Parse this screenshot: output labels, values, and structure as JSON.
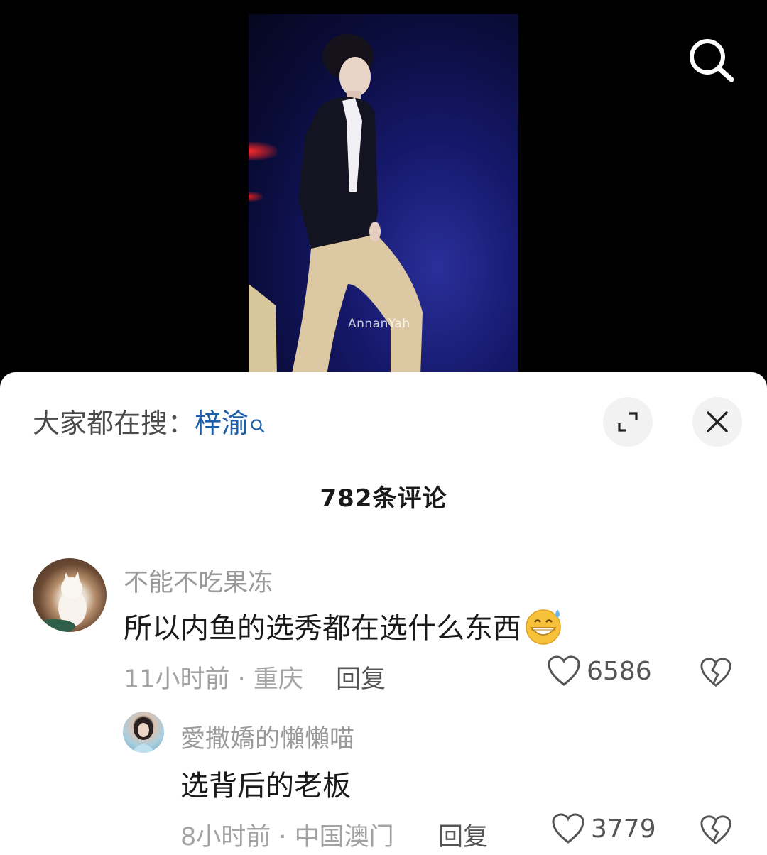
{
  "video": {
    "watermark": "AnnanYah"
  },
  "sheet": {
    "hot_search_label": "大家都在搜：",
    "hot_search_term": "梓渝",
    "comment_count": "782条评论"
  },
  "comments": [
    {
      "username": "不能不吃果冻",
      "text": "所以内鱼的选秀都在选什么东西",
      "emoji": "grinning-sweat-emoji",
      "time_location": "11小时前 · 重庆",
      "reply_label": "回复",
      "likes": "6586"
    }
  ],
  "replies": [
    {
      "username": "愛撒嬌的懶懶喵",
      "text": "选背后的老板",
      "time_location": "8小时前 · 中国澳门",
      "reply_label": "回复",
      "likes": "3779"
    }
  ],
  "icons": {
    "search": "search-icon",
    "expand": "expand-icon",
    "close": "close-icon",
    "like": "heart-icon",
    "dislike": "broken-heart-icon"
  },
  "colors": {
    "hot_search_term": "#1c5ea8",
    "sheet_bg": "#ffffff",
    "button_bg": "#f2f2f2"
  }
}
